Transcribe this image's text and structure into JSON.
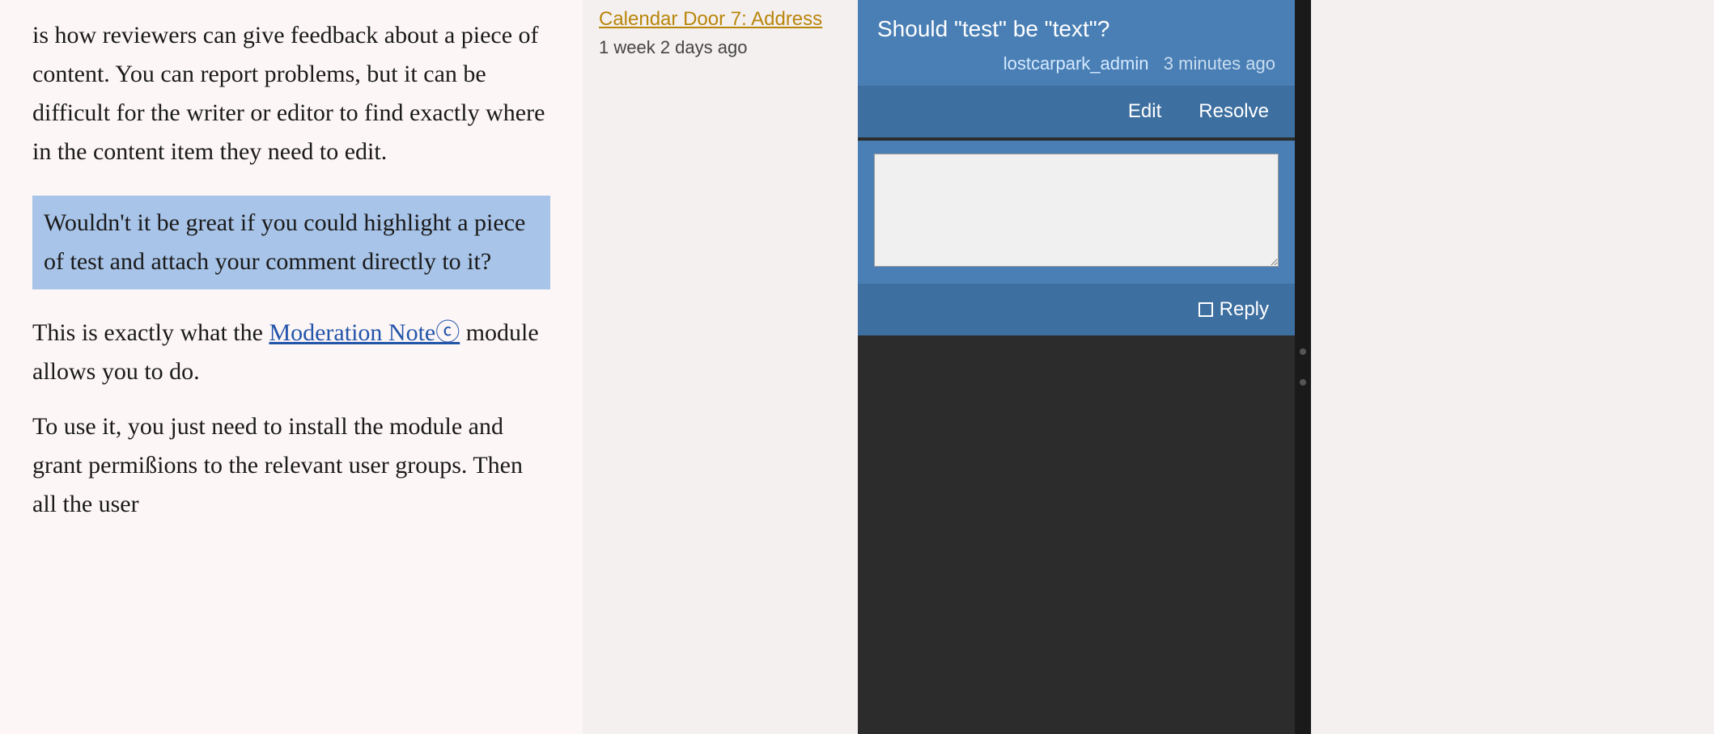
{
  "main": {
    "paragraph1": "is how reviewers can give feedback about a piece of content. You can report problems, but it can be difficult for the writer or editor to find exactly where in the content item they need to edit.",
    "highlighted_text": "Wouldn't it be great if you could highlight a piece of test and attach your comment directly to it?",
    "paragraph2_before": "This is exactly what the ",
    "paragraph2_link": "Moderation Noteⓒ",
    "paragraph2_after": " module allows you to do.",
    "paragraph3": "To use it, you just need to install the module and grant permißions to the relevant user groups. Then all the user"
  },
  "sidebar": {
    "link_text": "Calendar Door 7: Address",
    "meta_text": "1 week 2 days ago"
  },
  "comment": {
    "title": "Should \"test\" be \"text\"?",
    "username": "lostcarpark_admin",
    "time_ago": "3 minutes ago",
    "edit_label": "Edit",
    "resolve_label": "Resolve",
    "reply_placeholder": "",
    "reply_label": "Reply"
  }
}
